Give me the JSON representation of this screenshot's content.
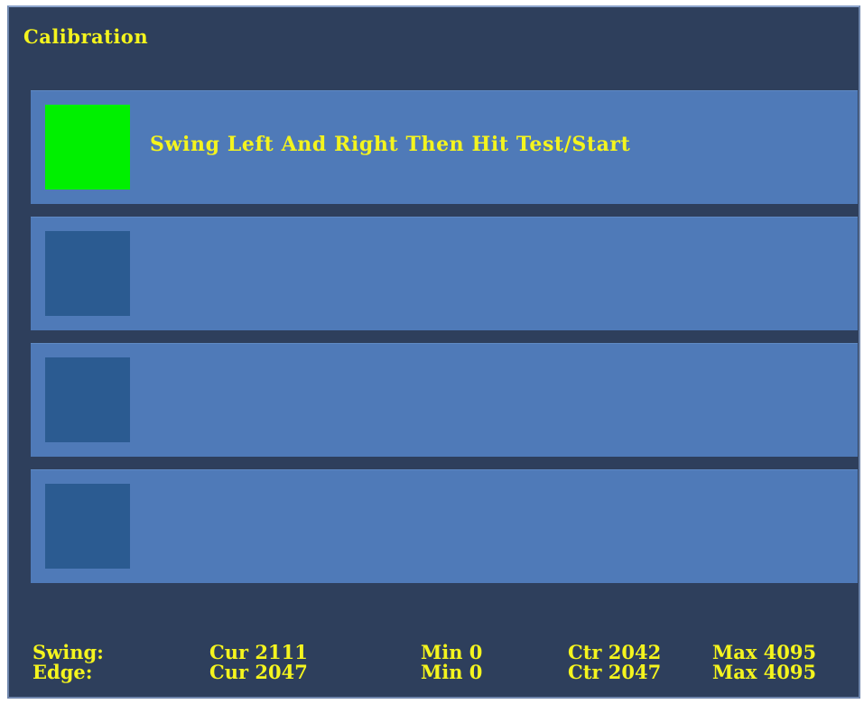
{
  "window": {
    "title": "Calibration"
  },
  "steps": [
    {
      "active": true,
      "indicator_color": "#00f000",
      "text": "Swing Left And Right Then Hit Test/Start"
    },
    {
      "active": false,
      "indicator_color": "#2b5b91",
      "text": ""
    },
    {
      "active": false,
      "indicator_color": "#2b5b91",
      "text": ""
    },
    {
      "active": false,
      "indicator_color": "#2b5b91",
      "text": ""
    }
  ],
  "readouts": [
    {
      "label": "Swing:",
      "cur": "Cur 2111",
      "min": "Min 0",
      "ctr": "Ctr 2042",
      "max": "Max 4095"
    },
    {
      "label": "Edge:",
      "cur": "Cur 2047",
      "min": "Min 0",
      "ctr": "Ctr 2047",
      "max": "Max 4095"
    }
  ],
  "colors": {
    "background": "#2e3f5c",
    "panel": "#4f7ab8",
    "text": "#f4f41e",
    "indicator_active": "#00f000",
    "indicator_inactive": "#2b5b91"
  }
}
